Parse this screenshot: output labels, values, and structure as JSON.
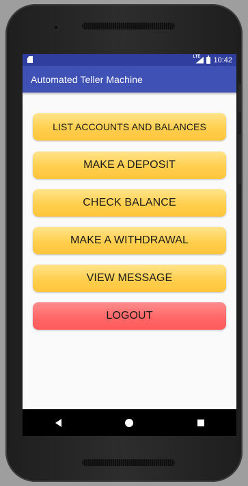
{
  "status_bar": {
    "time": "10:42",
    "network": "LTE"
  },
  "app_bar": {
    "title": "Automated Teller Machine"
  },
  "buttons": [
    {
      "label": "LIST ACCOUNTS AND BALANCES",
      "color": "#ffd04a"
    },
    {
      "label": "MAKE A DEPOSIT",
      "color": "#ffd04a"
    },
    {
      "label": "CHECK BALANCE",
      "color": "#ffd04a"
    },
    {
      "label": "MAKE A WITHDRAWAL",
      "color": "#ffd04a"
    },
    {
      "label": "VIEW MESSAGE",
      "color": "#ffd04a"
    },
    {
      "label": "LOGOUT",
      "color": "#ff6464"
    }
  ],
  "navigation": {
    "back_icon": "back-icon",
    "home_icon": "home-icon",
    "recent_apps_icon": "recent-apps-icon"
  },
  "colors": {
    "primary": "#3f51b5",
    "primary_dark": "#303f9f",
    "accent_yellow": "#ffd04a",
    "accent_red": "#ff6464"
  }
}
